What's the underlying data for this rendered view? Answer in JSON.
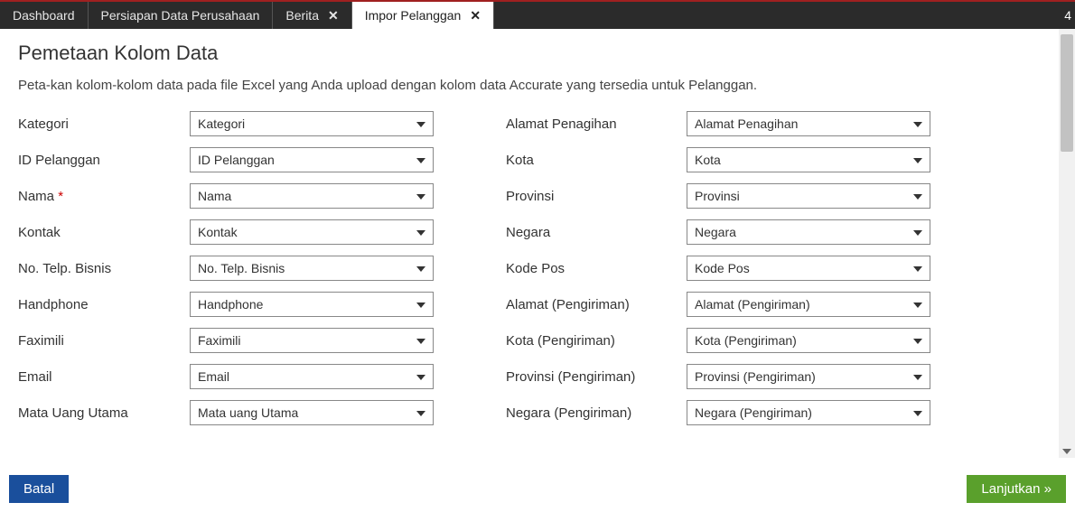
{
  "topbar": {
    "tabs": [
      {
        "label": "Dashboard",
        "closable": false
      },
      {
        "label": "Persiapan Data Perusahaan",
        "closable": false
      },
      {
        "label": "Berita",
        "closable": true
      },
      {
        "label": "Impor Pelanggan",
        "closable": true,
        "active": true
      }
    ],
    "right_text": "4"
  },
  "page": {
    "title": "Pemetaan Kolom Data",
    "description": "Peta-kan kolom-kolom data pada file Excel yang Anda upload dengan kolom data Accurate yang tersedia untuk Pelanggan."
  },
  "fields_left": [
    {
      "label": "Kategori",
      "value": "Kategori"
    },
    {
      "label": "ID Pelanggan",
      "value": "ID Pelanggan"
    },
    {
      "label": "Nama",
      "required": true,
      "value": "Nama"
    },
    {
      "label": "Kontak",
      "value": "Kontak"
    },
    {
      "label": "No. Telp. Bisnis",
      "value": "No. Telp. Bisnis"
    },
    {
      "label": "Handphone",
      "value": "Handphone"
    },
    {
      "label": "Faximili",
      "value": "Faximili"
    },
    {
      "label": "Email",
      "value": "Email"
    },
    {
      "label": "Mata Uang Utama",
      "value": "Mata uang Utama"
    }
  ],
  "fields_right": [
    {
      "label": "Alamat Penagihan",
      "value": "Alamat Penagihan"
    },
    {
      "label": "Kota",
      "value": "Kota"
    },
    {
      "label": "Provinsi",
      "value": "Provinsi"
    },
    {
      "label": "Negara",
      "value": "Negara"
    },
    {
      "label": "Kode Pos",
      "value": "Kode Pos"
    },
    {
      "label": "Alamat (Pengiriman)",
      "value": "Alamat (Pengiriman)"
    },
    {
      "label": "Kota (Pengiriman)",
      "value": "Kota (Pengiriman)"
    },
    {
      "label": "Provinsi (Pengiriman)",
      "value": "Provinsi (Pengiriman)"
    },
    {
      "label": "Negara (Pengiriman)",
      "value": "Negara (Pengiriman)"
    }
  ],
  "footer": {
    "cancel": "Batal",
    "continue": "Lanjutkan »"
  }
}
